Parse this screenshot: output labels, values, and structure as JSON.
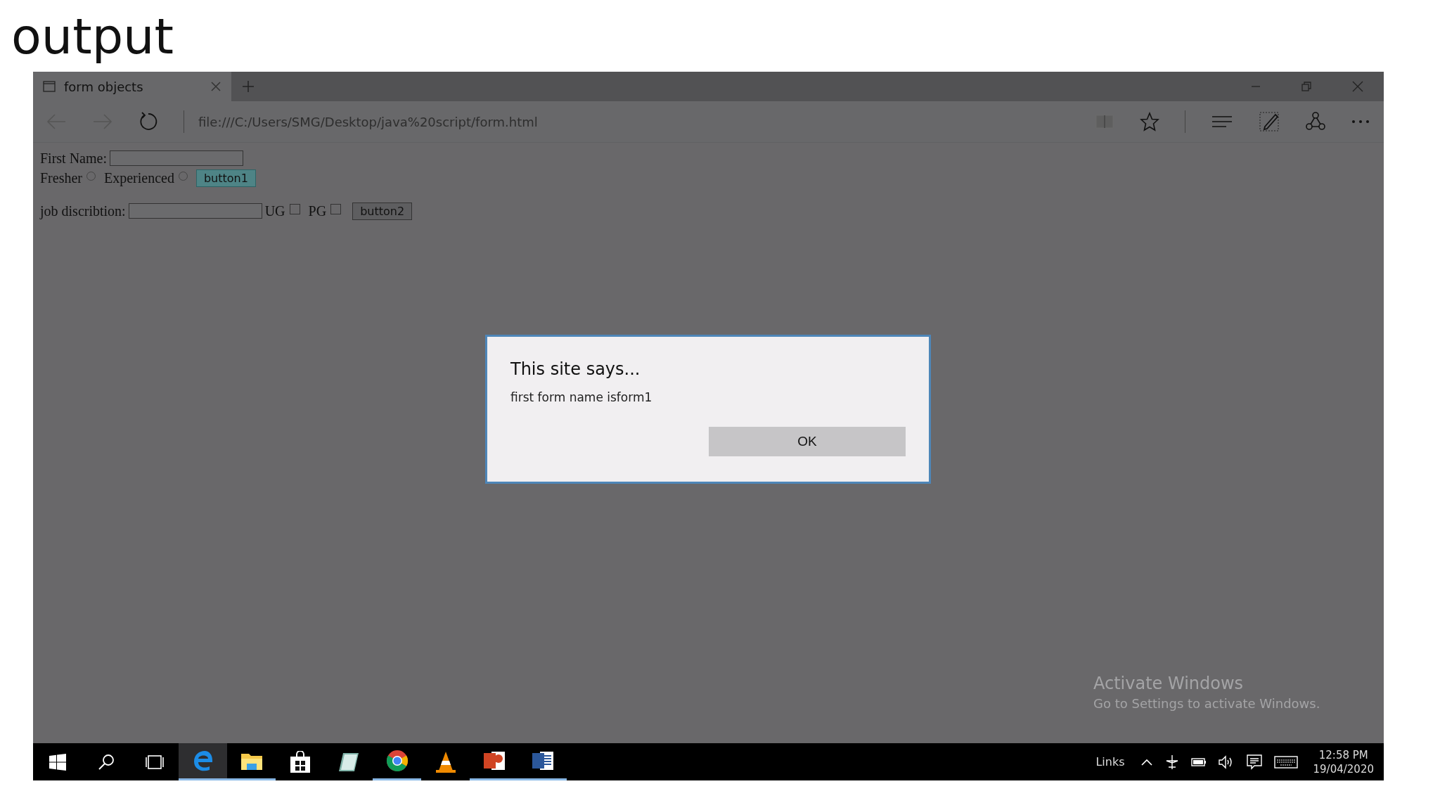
{
  "slide_title": "output",
  "browser": {
    "tab": {
      "title": "form objects",
      "selected": true
    },
    "url": "file:///C:/Users/SMG/Desktop/java%20script/form.html"
  },
  "form": {
    "first_name_label": "First Name:",
    "radios": [
      {
        "label": "Fresher",
        "checked": false
      },
      {
        "label": "Experienced",
        "checked": false
      }
    ],
    "button1": "button1",
    "job_label": "job discribtion:",
    "checkboxes": [
      {
        "label": "UG",
        "checked": false
      },
      {
        "label": "PG",
        "checked": false
      }
    ],
    "button2": "button2"
  },
  "dialog": {
    "title": "This site says...",
    "message": "first form name isform1",
    "ok": "OK"
  },
  "activation": {
    "title": "Activate Windows",
    "subtitle": "Go to Settings to activate Windows."
  },
  "taskbar": {
    "apps": [
      {
        "kind": "edge",
        "running": true,
        "selected": true
      },
      {
        "kind": "explorer",
        "running": true,
        "selected": false
      },
      {
        "kind": "store",
        "running": false,
        "selected": false
      },
      {
        "kind": "notepad",
        "running": false,
        "selected": false
      },
      {
        "kind": "chrome",
        "running": true,
        "selected": false
      },
      {
        "kind": "vlc",
        "running": false,
        "selected": false
      },
      {
        "kind": "powerpoint",
        "running": true,
        "selected": false
      },
      {
        "kind": "word",
        "running": true,
        "selected": false
      }
    ],
    "links": "Links",
    "time": "12:58 PM",
    "date": "19/04/2020"
  }
}
